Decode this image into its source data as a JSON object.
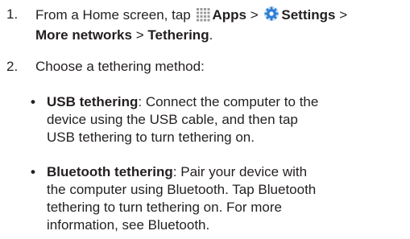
{
  "steps": [
    {
      "number": "1.",
      "line1_prefix": "From a Home screen, tap",
      "apps_icon": "apps-grid-icon",
      "apps_label": "Apps",
      "sep1": ">",
      "settings_icon": "settings-gear-icon",
      "settings_label": "Settings",
      "sep2": ">",
      "more_networks": "More networks",
      "sep3": ">",
      "tethering": "Tethering",
      "end": "."
    },
    {
      "number": "2.",
      "text": "Choose a tethering method:"
    }
  ],
  "bullets": [
    {
      "dot": "•",
      "title": "USB tethering",
      "colon": ":",
      "line1": "Connect the computer to the",
      "line2": "device using the USB cable, and then tap",
      "line3": "USB tethering to turn tethering on."
    },
    {
      "dot": "•",
      "title": "Bluetooth tethering",
      "colon": ":",
      "line1": "Pair your device with",
      "line2": "the computer using Bluetooth. Tap Bluetooth",
      "line3": "tethering to turn tethering on. For more",
      "line4": "information, see Bluetooth."
    }
  ],
  "colors": {
    "text": "#231f20",
    "icon_dots": "#9a9a9a",
    "gear_blue": "#2f7fd4"
  }
}
